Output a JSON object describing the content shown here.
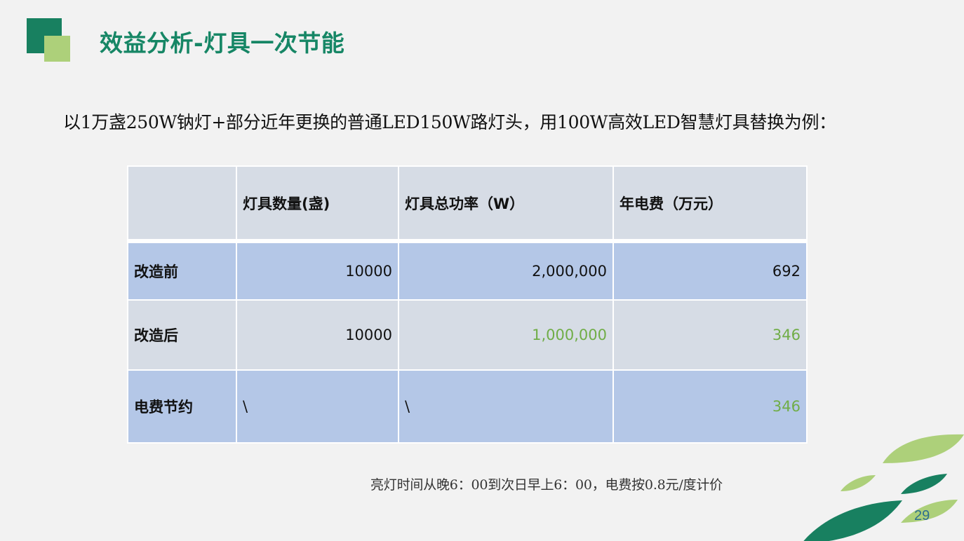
{
  "slide": {
    "title": "效益分析-灯具一次节能",
    "intro": "以1万盏250W钠灯+部分近年更换的普通LED150W路灯头，用100W高效LED智慧灯具替换为例：",
    "page_number": "29"
  },
  "table": {
    "headers": [
      "",
      "灯具数量(盏)",
      "灯具总功率（W）",
      "年电费（万元）"
    ],
    "rows": [
      {
        "label": "改造前",
        "quantity": "10000",
        "power": "2,000,000",
        "cost": "692"
      },
      {
        "label": "改造后",
        "quantity": "10000",
        "power": "1,000,000",
        "cost": "346"
      },
      {
        "label": "电费节约",
        "quantity": "\\",
        "power": "\\",
        "cost": "346"
      }
    ]
  },
  "footnote": "亮灯时间从晚6：00到次日早上6：00，电费按0.8元/度计价",
  "colors": {
    "title": "#168665",
    "logo_dark": "#188060",
    "logo_light": "#add07a",
    "header_cell": "#d6dce5",
    "blue_cell": "#b4c7e7",
    "highlight_value": "#70ad47"
  }
}
